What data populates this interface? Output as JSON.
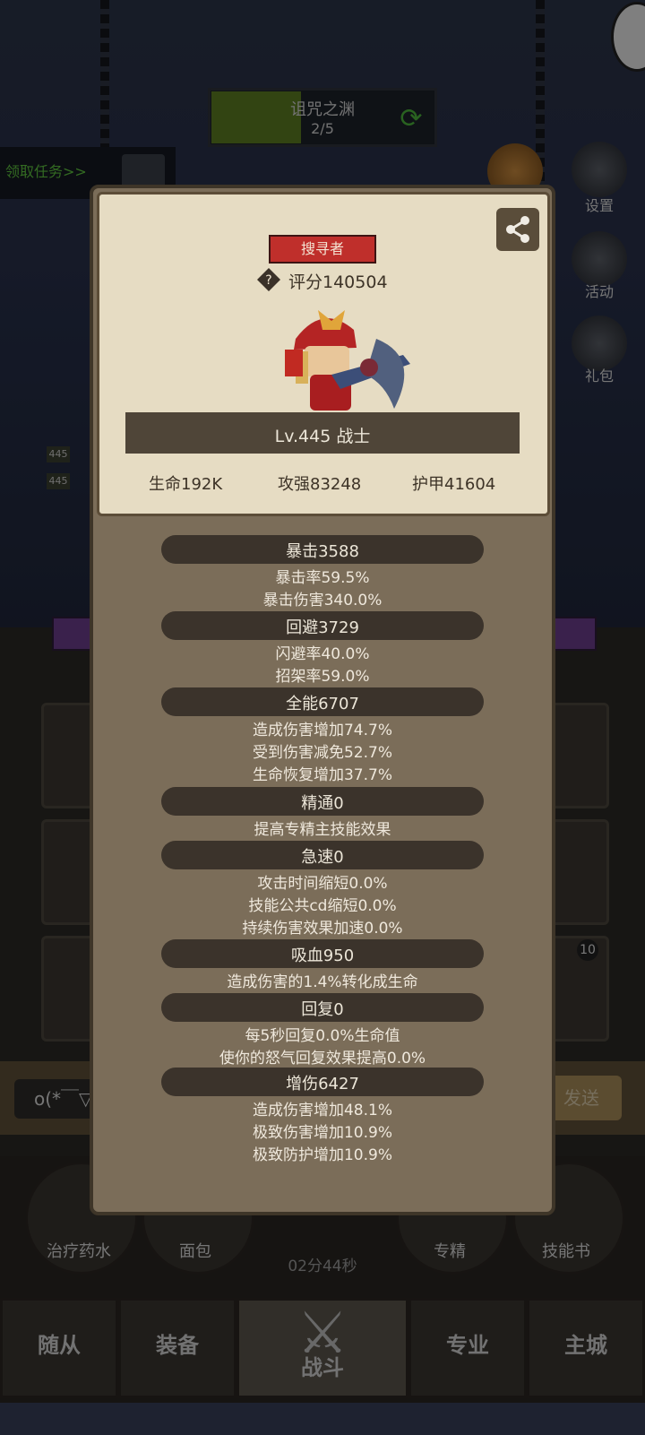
{
  "background": {
    "zone_name": "诅咒之渊",
    "zone_progress": "2/5",
    "task_button": "领取任务>>",
    "side_buttons": [
      "设置",
      "活动",
      "礼包"
    ],
    "hp_tags": [
      "445",
      "445"
    ],
    "chat_placeholder": "o(*￣▽",
    "send_label": "发送",
    "slot_badge": "10",
    "consumables": [
      "治疗药水",
      "面包",
      "专精",
      "技能书"
    ],
    "timer": "02分44秒",
    "bottom_tabs": [
      "随从",
      "装备",
      "战斗",
      "专业",
      "主城"
    ]
  },
  "hero_card": {
    "title": "搜寻者",
    "score": "评分140504",
    "level": "Lv.445 战士",
    "stats": {
      "hp": "生命192K",
      "attack": "攻强83248",
      "armor": "护甲41604"
    }
  },
  "sections": [
    {
      "header": "暴击3588",
      "lines": [
        "暴击率59.5%",
        "暴击伤害340.0%"
      ]
    },
    {
      "header": "回避3729",
      "lines": [
        "闪避率40.0%",
        "招架率59.0%"
      ]
    },
    {
      "header": "全能6707",
      "lines": [
        "造成伤害增加74.7%",
        "受到伤害减免52.7%",
        "生命恢复增加37.7%"
      ]
    },
    {
      "header": "精通0",
      "lines": [
        "提高专精主技能效果"
      ]
    },
    {
      "header": "急速0",
      "lines": [
        "攻击时间缩短0.0%",
        "技能公共cd缩短0.0%",
        "持续伤害效果加速0.0%"
      ]
    },
    {
      "header": "吸血950",
      "lines": [
        "造成伤害的1.4%转化成生命"
      ]
    },
    {
      "header": "回复0",
      "lines": [
        "每5秒回复0.0%生命值",
        "使你的怒气回复效果提高0.0%"
      ]
    },
    {
      "header": "增伤6427",
      "lines": [
        "造成伤害增加48.1%",
        "极致伤害增加10.9%",
        "极致防护增加10.9%"
      ]
    }
  ]
}
